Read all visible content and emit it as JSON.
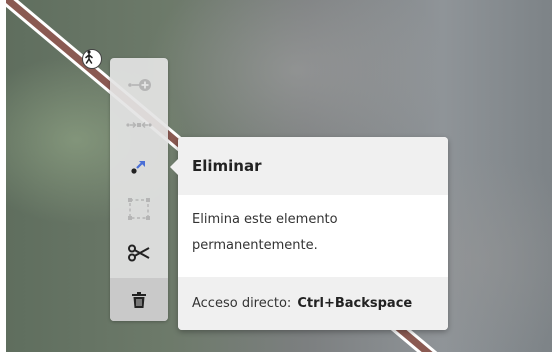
{
  "toolbar": {
    "tools": [
      {
        "name": "continue-line-tool",
        "icon": "continue-icon",
        "state": "disabled"
      },
      {
        "name": "disconnect-tool",
        "icon": "disconnect-icon",
        "state": "disabled"
      },
      {
        "name": "extract-tool",
        "icon": "extract-icon",
        "state": "enabled"
      },
      {
        "name": "circularize-tool",
        "icon": "square-dashed-icon",
        "state": "disabled"
      },
      {
        "name": "split-tool",
        "icon": "scissors-icon",
        "state": "enabled"
      },
      {
        "name": "delete-tool",
        "icon": "trash-icon",
        "state": "active"
      }
    ]
  },
  "tooltip": {
    "title": "Eliminar",
    "description": "Elimina este elemento permanentemente.",
    "shortcut_label": "Acceso directo:",
    "shortcut_keys": "Ctrl+Backspace"
  },
  "colors": {
    "road_fill": "#8a5a52",
    "road_edge": "#ffffff",
    "accent_blue": "#4a6fd6",
    "disabled_icon": "#b5b5b5"
  }
}
